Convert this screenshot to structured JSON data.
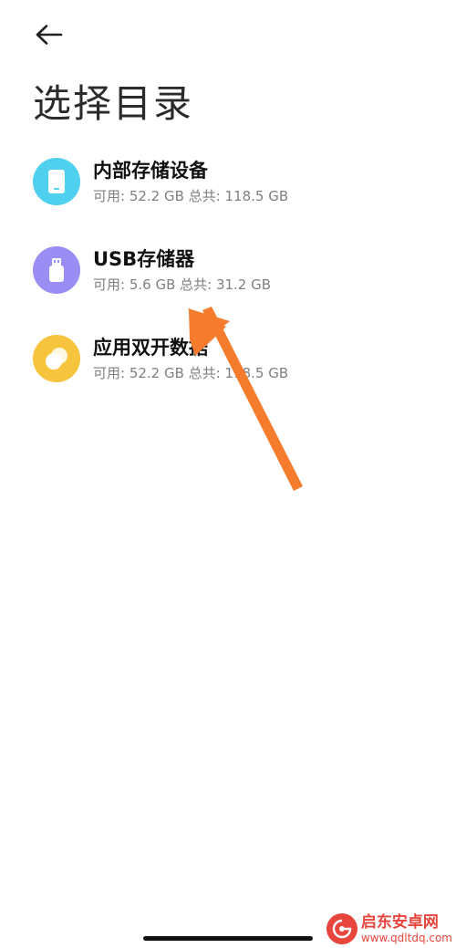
{
  "header": {
    "title": "选择目录"
  },
  "storage_items": [
    {
      "name": "内部存储设备",
      "detail": "可用: 52.2 GB 总共: 118.5 GB",
      "icon": "phone-storage-icon",
      "color": "#4fd0ef"
    },
    {
      "name": "USB存储器",
      "detail": "可用: 5.6 GB 总共: 31.2 GB",
      "icon": "usb-drive-icon",
      "color": "#9a8df3"
    },
    {
      "name": "应用双开数据",
      "detail": "可用: 52.2 GB 总共: 118.5 GB",
      "icon": "dual-app-icon",
      "color": "#f7c53d"
    }
  ],
  "colors": {
    "annotation_arrow": "#f47c2c"
  },
  "watermark": {
    "name": "启东安卓网",
    "url": "www.qdltdq.com"
  }
}
